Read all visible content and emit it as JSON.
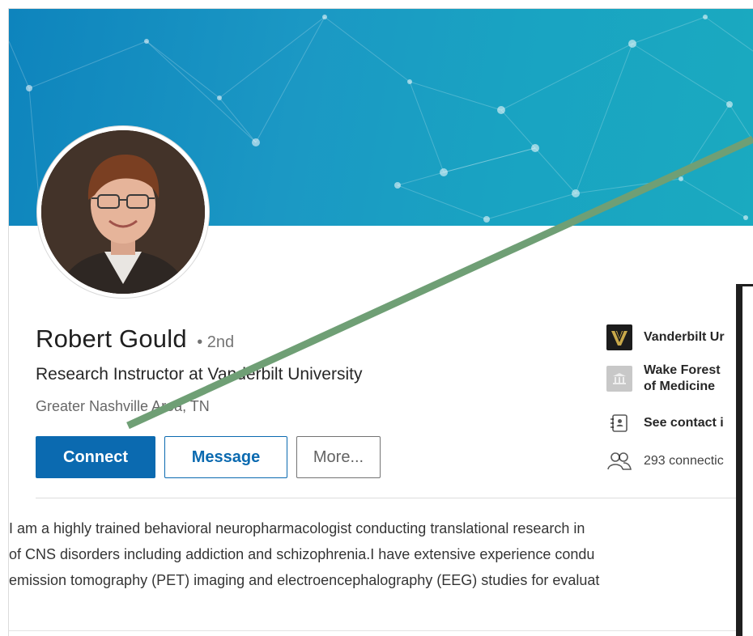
{
  "profile": {
    "name": "Robert Gould",
    "degree": "• 2nd",
    "headline": "Research Instructor at Vanderbilt University",
    "location": "Greater Nashville Area, TN"
  },
  "actions": {
    "connect_label": "Connect",
    "message_label": "Message",
    "more_label": "More..."
  },
  "sidebar": {
    "items": [
      {
        "label": "Vanderbilt Ur",
        "icon": "vanderbilt-logo-icon"
      },
      {
        "label_line1": "Wake Forest",
        "label_line2": "of Medicine",
        "icon": "school-building-icon"
      },
      {
        "label": "See contact i",
        "icon": "contact-card-icon"
      },
      {
        "label": "293 connectic",
        "icon": "connections-people-icon"
      }
    ]
  },
  "summary": {
    "lines": [
      "I am a highly trained behavioral neuropharmacologist conducting translational research in",
      "of CNS disorders including addiction and schizophrenia.I have extensive experience condu",
      "emission tomography (PET) imaging and electroencephalography (EEG) studies for evaluat"
    ]
  },
  "colors": {
    "primary": "#0b6ab0",
    "banner": "#1a9dc3",
    "annotation_line": "#6e9e74"
  }
}
